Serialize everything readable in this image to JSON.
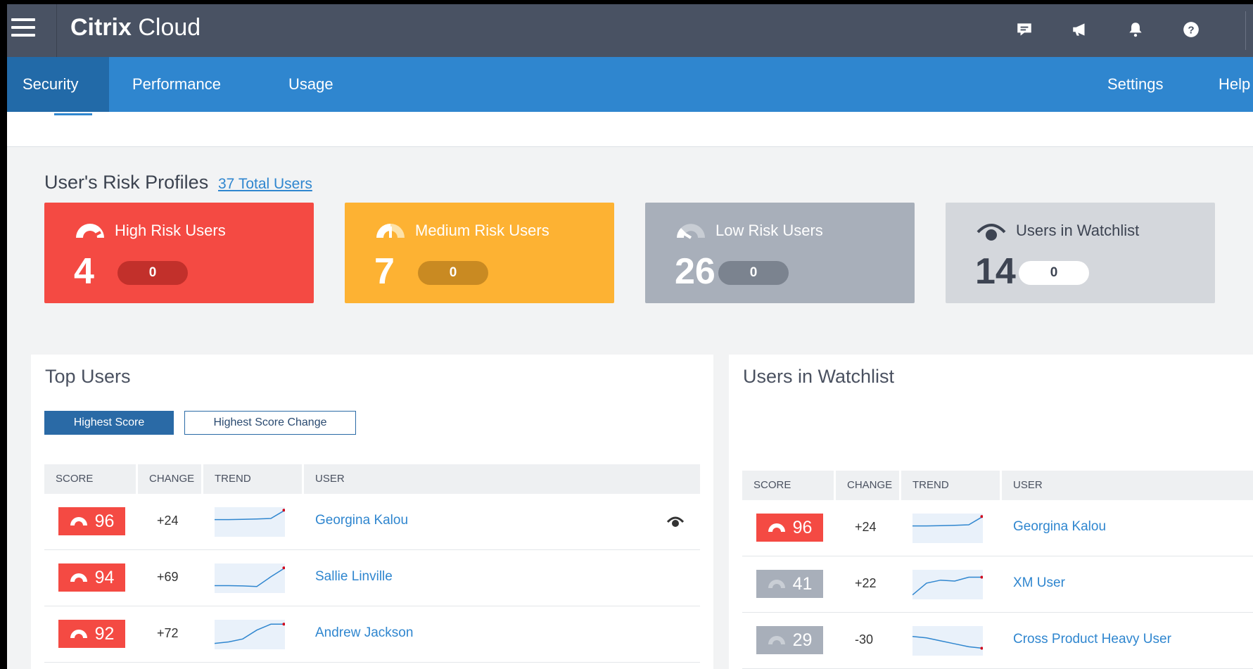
{
  "app": {
    "brand_bold": "Citrix",
    "brand_light": "Cloud"
  },
  "colors": {
    "topbar": "#495263",
    "navbar": "#2f86cf",
    "high": "#f44a43",
    "medium": "#fdb233",
    "low": "#a8afba",
    "watch": "#d4d7dc"
  },
  "header_icons": [
    "chat-icon",
    "megaphone-icon",
    "bell-icon",
    "help-icon"
  ],
  "nav": {
    "tabs": [
      "Security",
      "Performance",
      "Usage"
    ],
    "right": [
      "Settings",
      "Help"
    ],
    "active": "Security"
  },
  "risk": {
    "title": "User's Risk Profiles",
    "total_link": "37 Total Users",
    "cards": [
      {
        "label": "High Risk Users",
        "count": "4",
        "badge": "0",
        "icon": "gauge-high-icon"
      },
      {
        "label": "Medium Risk Users",
        "count": "7",
        "badge": "0",
        "icon": "gauge-medium-icon"
      },
      {
        "label": "Low Risk Users",
        "count": "26",
        "badge": "0",
        "icon": "gauge-low-icon"
      },
      {
        "label": "Users in Watchlist",
        "count": "14",
        "badge": "0",
        "icon": "eye-icon"
      }
    ]
  },
  "top_users": {
    "title": "Top Users",
    "toggle": {
      "on": "Highest Score",
      "off": "Highest Score Change"
    },
    "columns": [
      "SCORE",
      "CHANGE",
      "TREND",
      "USER"
    ],
    "rows": [
      {
        "score": "96",
        "change": "+24",
        "user": "Georgina Kalou",
        "level": "high",
        "trend": [
          0.42,
          0.42,
          0.41,
          0.4,
          0.38,
          0.1
        ],
        "watch": true
      },
      {
        "score": "94",
        "change": "+69",
        "user": "Sallie Linville",
        "level": "high",
        "trend": [
          0.75,
          0.75,
          0.76,
          0.78,
          0.45,
          0.15
        ],
        "watch": false
      },
      {
        "score": "92",
        "change": "+72",
        "user": "Andrew Jackson",
        "level": "high",
        "trend": [
          0.8,
          0.75,
          0.65,
          0.35,
          0.15,
          0.15
        ],
        "watch": false
      }
    ]
  },
  "watchlist": {
    "title": "Users in Watchlist",
    "columns": [
      "SCORE",
      "CHANGE",
      "TREND",
      "USER"
    ],
    "rows": [
      {
        "score": "96",
        "change": "+24",
        "user": "Georgina Kalou",
        "level": "high",
        "trend": [
          0.42,
          0.42,
          0.41,
          0.4,
          0.38,
          0.1
        ]
      },
      {
        "score": "41",
        "change": "+22",
        "user": "XM User",
        "level": "low",
        "trend": [
          0.85,
          0.45,
          0.35,
          0.38,
          0.25,
          0.25
        ]
      },
      {
        "score": "29",
        "change": "-30",
        "user": "Cross Product Heavy User",
        "level": "low",
        "trend": [
          0.35,
          0.4,
          0.5,
          0.6,
          0.7,
          0.75
        ]
      }
    ]
  }
}
